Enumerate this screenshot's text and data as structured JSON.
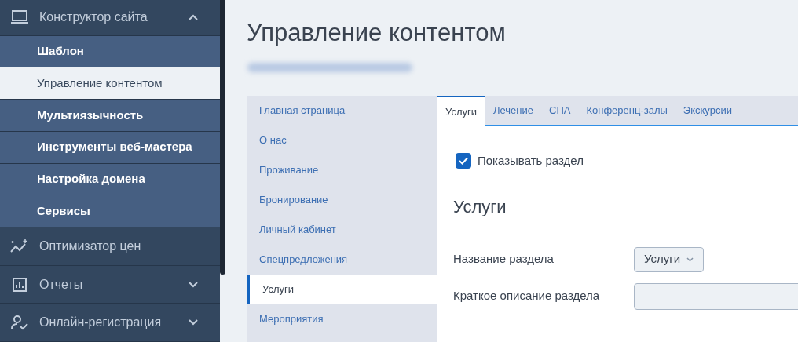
{
  "sidebar": {
    "sections": [
      {
        "kind": "laptop",
        "label": "Конструктор сайта",
        "expanded": true,
        "children": [
          {
            "label": "Шаблон",
            "selected": false
          },
          {
            "label": "Управление контентом",
            "selected": true
          },
          {
            "label": "Мультиязычность",
            "selected": false
          },
          {
            "label": "Инструменты веб-мастера",
            "selected": false
          },
          {
            "label": "Настройка домена",
            "selected": false
          },
          {
            "label": "Сервисы",
            "selected": false
          }
        ]
      },
      {
        "kind": "chart-line",
        "label": "Оптимизатор цен"
      },
      {
        "kind": "bar-chart",
        "label": "Отчеты",
        "expanded": false
      },
      {
        "kind": "user-check",
        "label": "Онлайн-регистрация",
        "expanded": false
      }
    ]
  },
  "page": {
    "title": "Управление контентом"
  },
  "pages_nav": [
    {
      "label": "Главная страница",
      "selected": false
    },
    {
      "label": "О нас",
      "selected": false
    },
    {
      "label": "Проживание",
      "selected": false
    },
    {
      "label": "Бронирование",
      "selected": false
    },
    {
      "label": "Личный кабинет",
      "selected": false
    },
    {
      "label": "Спецпредложения",
      "selected": false
    },
    {
      "label": "Услуги",
      "selected": true
    },
    {
      "label": "Мероприятия",
      "selected": false
    }
  ],
  "tabs": [
    {
      "label": "Услуги",
      "selected": true
    },
    {
      "label": "Лечение",
      "selected": false
    },
    {
      "label": "СПА",
      "selected": false
    },
    {
      "label": "Конференц-залы",
      "selected": false
    },
    {
      "label": "Экскурсии",
      "selected": false
    }
  ],
  "form": {
    "show_section": {
      "label": "Показывать раздел",
      "checked": true
    },
    "heading": "Услуги",
    "fields": [
      {
        "kind": "dropdown",
        "label": "Название раздела",
        "value": "Услуги"
      },
      {
        "kind": "text",
        "label": "Краткое описание раздела"
      }
    ]
  }
}
